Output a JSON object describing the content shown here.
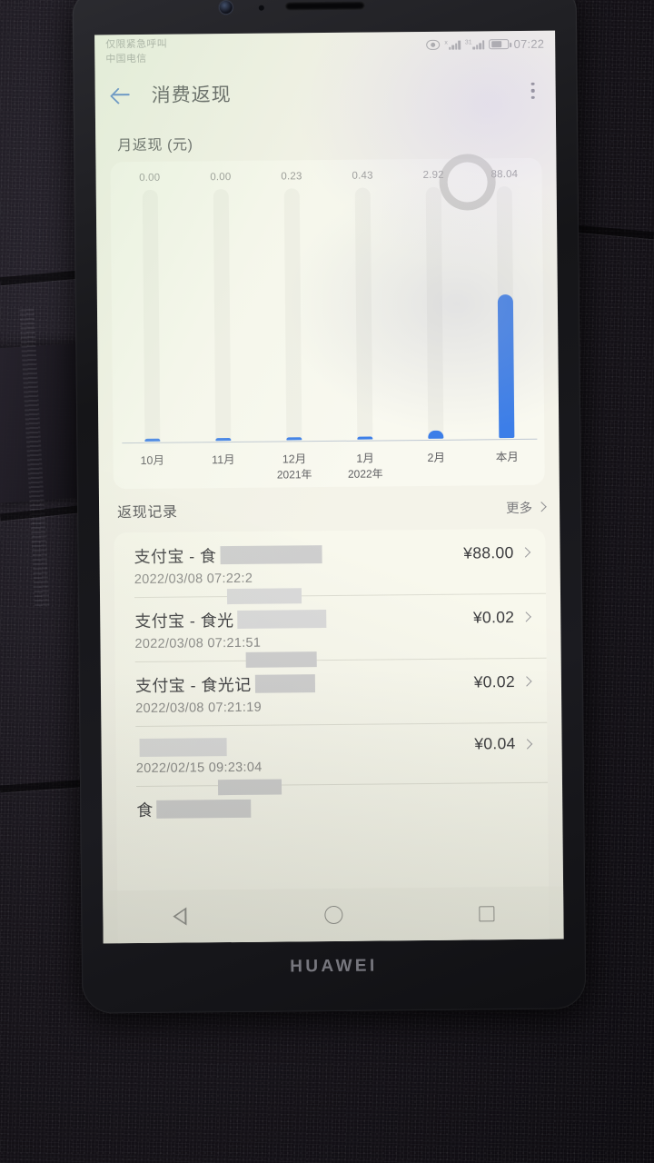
{
  "device": {
    "brand": "HUAWEI"
  },
  "statusbar": {
    "carrier_line1": "仅限紧急呼叫",
    "carrier_line2": "中国电信",
    "clock": "07:22",
    "battery_label": "64",
    "icons": [
      "eye-icon",
      "signal-icon",
      "signal-icon",
      "battery-icon"
    ]
  },
  "appbar": {
    "title": "消费返现",
    "back_icon": "back-arrow-icon",
    "menu_icon": "kebab-menu-icon"
  },
  "chart_section": {
    "title": "月返现 (元)"
  },
  "chart_data": {
    "type": "bar",
    "title": "月返现 (元)",
    "categories": [
      "10月",
      "11月",
      "12月",
      "1月",
      "2月",
      "本月"
    ],
    "category_sublabels": [
      "",
      "",
      "2021年",
      "2022年",
      "",
      ""
    ],
    "values": [
      0.0,
      0.0,
      0.23,
      0.43,
      2.92,
      88.04
    ],
    "value_labels": [
      "0.00",
      "0.00",
      "0.23",
      "0.43",
      "2.92",
      "88.04"
    ],
    "xlabel": "",
    "ylabel": "元",
    "ylim": [
      0,
      88.04
    ],
    "grid": false,
    "legend": "none",
    "bar_color": "#3c7ee8",
    "track_color": "#e9e8df"
  },
  "records_section": {
    "title": "返现记录",
    "more_label": "更多",
    "more_icon": "chevron-right-icon",
    "rows": [
      {
        "name_prefix": "支付宝 - 食",
        "censored": true,
        "amount": "¥88.00",
        "date": "2022/03/08 07:22:2"
      },
      {
        "name_prefix": "支付宝 - 食光",
        "censored": true,
        "amount": "¥0.02",
        "date": "2022/03/08 07:21:51"
      },
      {
        "name_prefix": "支付宝 - 食光记",
        "censored": true,
        "amount": "¥0.02",
        "date": "2022/03/08 07:21:19"
      },
      {
        "name_prefix": "",
        "censored": true,
        "amount": "¥0.04",
        "date": "2022/02/15 09:23:04"
      },
      {
        "name_prefix": "食",
        "censored": true,
        "amount": "",
        "date": ""
      }
    ]
  },
  "assistive_touch": {
    "label": "assistive-touch-ring"
  },
  "navbar": {
    "back_label": "back-triangle-icon",
    "home_label": "home-circle-icon",
    "recents_label": "recents-square-icon"
  },
  "colors": {
    "accent": "#3c7ee8",
    "screen_bg": "#f4f3e9",
    "text": "#3f3f42"
  }
}
